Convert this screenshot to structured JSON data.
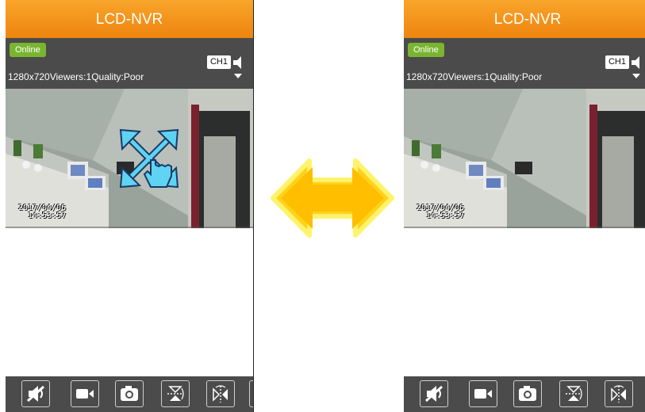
{
  "app": {
    "title": "LCD-NVR"
  },
  "status": {
    "badge": "Online",
    "stream_info": "1280x720Viewers:1Quality:Poor"
  },
  "channel": {
    "label": "CH1"
  },
  "video": {
    "timestamp_date": "2017/04/06",
    "timestamp_time": "14:53:57"
  },
  "toolbar": {
    "buttons": [
      "mute-icon",
      "record-video-icon",
      "snapshot-icon",
      "flip-vertical-icon",
      "mirror-horizontal-icon"
    ]
  },
  "colors": {
    "titlebar": "#f29018",
    "bar": "#4b4b4b",
    "online": "#7ab52f",
    "arrow": "#ffc000",
    "gesture": "#5fd3f2"
  }
}
